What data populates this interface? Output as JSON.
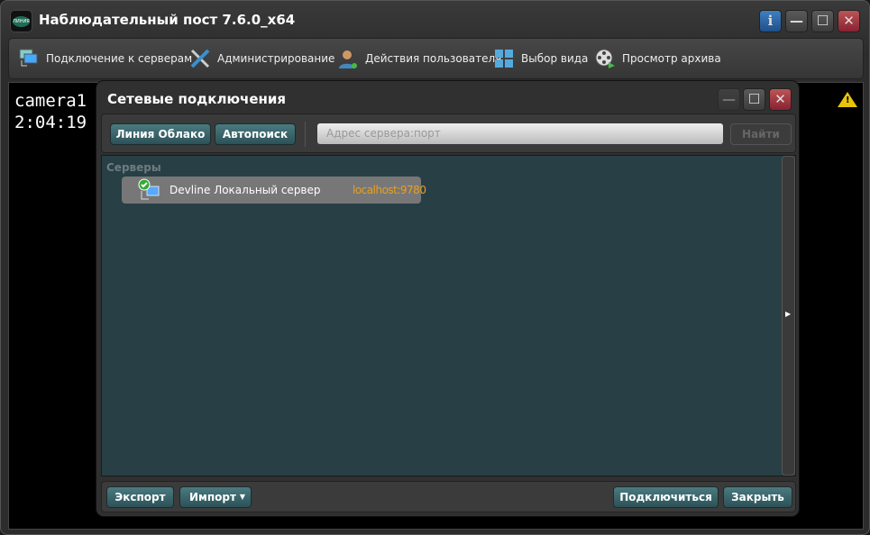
{
  "window": {
    "title": "Наблюдательный пост 7.6.0_x64",
    "logo_text": "ЛИНИЯ",
    "info": "i"
  },
  "toolbar": [
    {
      "label": "Подключение к серверам",
      "icon": "monitors-icon"
    },
    {
      "label": "Администрирование",
      "icon": "tools-icon"
    },
    {
      "label": "Действия пользователя",
      "icon": "user-icon"
    },
    {
      "label": "Выбор вида",
      "icon": "grid-icon"
    },
    {
      "label": "Просмотр архива",
      "icon": "film-reel-icon"
    }
  ],
  "camera": {
    "name": "camera1",
    "time": "2:04:19"
  },
  "dialog": {
    "title": "Сетевые подключения",
    "cloud_button": "Линия Облако",
    "autosearch_button": "Автопоиск",
    "address_placeholder": "Адрес сервера:порт",
    "find_button": "Найти",
    "group_label": "Серверы",
    "servers": [
      {
        "name": "Devline Локальный сервер",
        "address": "localhost:9780",
        "status": "connected"
      }
    ],
    "export_button": "Экспорт",
    "import_button": "Импорт",
    "connect_button": "Подключиться",
    "close_button": "Закрыть"
  },
  "colors": {
    "accent": "#3d6b70",
    "address": "#e8a020",
    "list_bg": "#283f46"
  }
}
